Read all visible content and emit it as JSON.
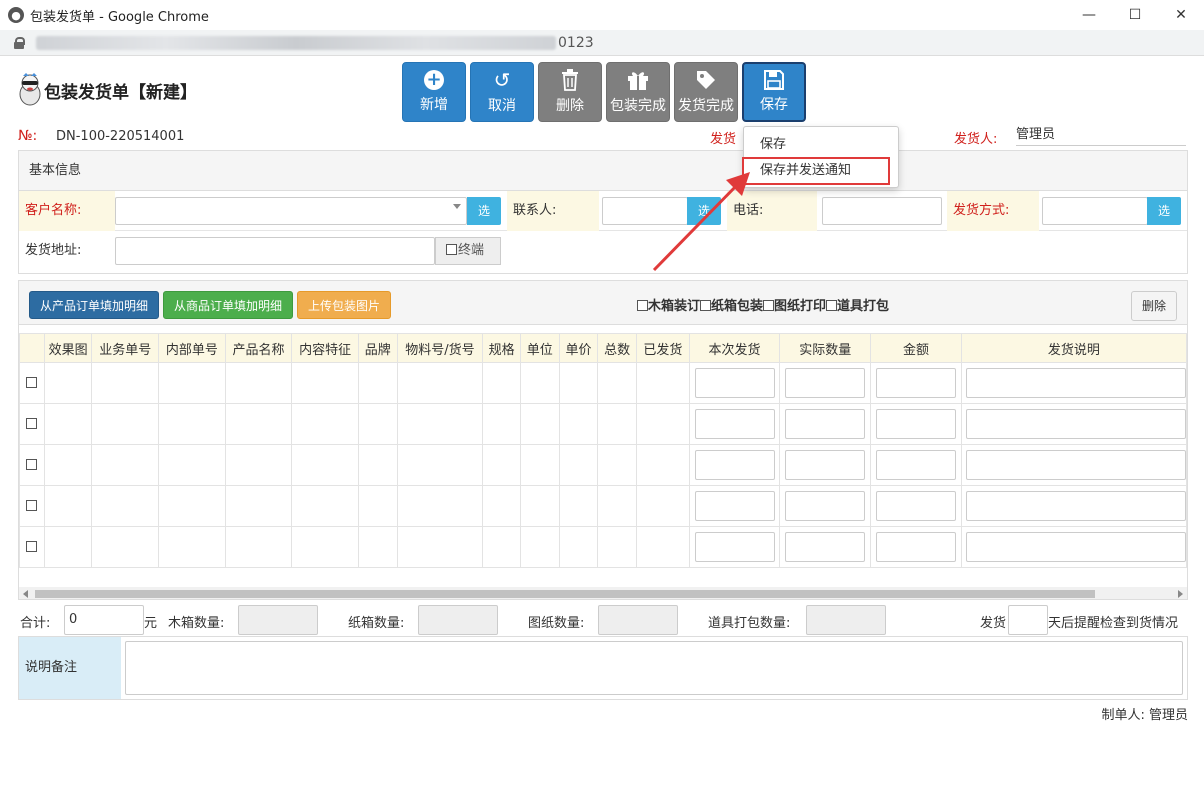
{
  "window": {
    "title": "包装发货单 - Google Chrome",
    "url_tail": "0123"
  },
  "page": {
    "title": "包装发货单【新建】"
  },
  "toolbar": {
    "add": "新增",
    "cancel": "取消",
    "delete": "删除",
    "pack_done": "包装完成",
    "ship_done": "发货完成",
    "save": "保存"
  },
  "save_menu": {
    "save": "保存",
    "save_notify": "保存并发送通知"
  },
  "header": {
    "no_label": "№:",
    "no_value": "DN-100-220514001",
    "ship_date_label": "发货",
    "shipper_label": "发货人:",
    "shipper_value": "管理员"
  },
  "basic": {
    "title": "基本信息",
    "customer_label": "客户名称:",
    "select": "选",
    "contact_label": "联系人:",
    "phone_label": "电话:",
    "ship_method_label": "发货方式:",
    "address_label": "发货地址:",
    "terminal_label": "终端"
  },
  "detail": {
    "from_product_order": "从产品订单填加明细",
    "from_goods_order": "从商品订单填加明细",
    "upload_image": "上传包装图片",
    "opt_wood": "木箱装订",
    "opt_carton": "纸箱包装",
    "opt_drawing": "图纸打印",
    "opt_prop": "道具打包",
    "delete": "删除",
    "columns": [
      "效果图",
      "业务单号",
      "内部单号",
      "产品名称",
      "内容特征",
      "品牌",
      "物料号/货号",
      "规格",
      "单位",
      "单价",
      "总数",
      "已发货",
      "本次发货",
      "实际数量",
      "金额",
      "发货说明"
    ]
  },
  "totals": {
    "sum_label": "合计:",
    "sum_value": "0",
    "yuan": "元",
    "wood_qty": "木箱数量:",
    "carton_qty": "纸箱数量:",
    "drawing_qty": "图纸数量:",
    "prop_qty": "道具打包数量:",
    "ship_label": "发货",
    "remind_text": "天后提醒检查到货情况"
  },
  "remark": {
    "label": "说明备注"
  },
  "footer": {
    "maker": "制单人:  管理员"
  },
  "colors": {
    "primary": "#2f84c9",
    "danger": "#d0201c",
    "highlight": "#e03a3a"
  }
}
